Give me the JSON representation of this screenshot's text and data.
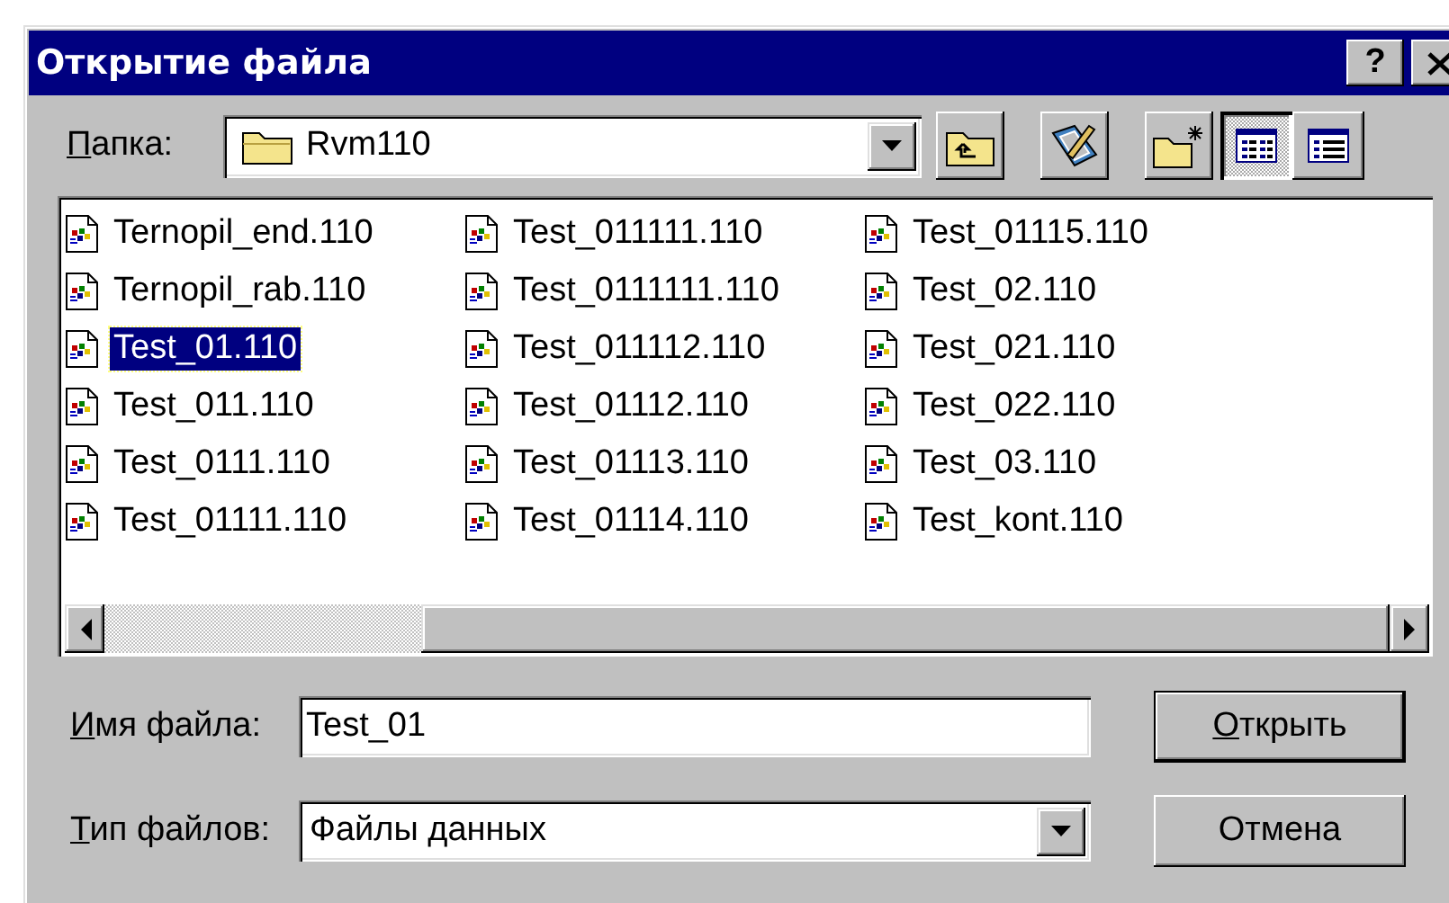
{
  "window": {
    "title": "Открытие файла",
    "help_button": "?"
  },
  "folder": {
    "label": "Папка:",
    "mnemonic": true,
    "value": "Rvm110"
  },
  "views": [
    {
      "kind": "list",
      "selected": true
    },
    {
      "kind": "details",
      "selected": false
    }
  ],
  "files": [
    {
      "name": "Ternopil_end.110",
      "selected": false
    },
    {
      "name": "Ternopil_rab.110",
      "selected": false
    },
    {
      "name": "Test_01.110",
      "selected": true
    },
    {
      "name": "Test_011.110",
      "selected": false
    },
    {
      "name": "Test_0111.110",
      "selected": false
    },
    {
      "name": "Test_01111.110",
      "selected": false
    },
    {
      "name": "Test_011111.110",
      "selected": false
    },
    {
      "name": "Test_0111111.110",
      "selected": false
    },
    {
      "name": "Test_011112.110",
      "selected": false
    },
    {
      "name": "Test_01112.110",
      "selected": false
    },
    {
      "name": "Test_01113.110",
      "selected": false
    },
    {
      "name": "Test_01114.110",
      "selected": false
    },
    {
      "name": "Test_01115.110",
      "selected": false
    },
    {
      "name": "Test_02.110",
      "selected": false
    },
    {
      "name": "Test_021.110",
      "selected": false
    },
    {
      "name": "Test_022.110",
      "selected": false
    },
    {
      "name": "Test_03.110",
      "selected": false
    },
    {
      "name": "Test_kont.110",
      "selected": false
    }
  ],
  "file_name": {
    "label": "Имя файла:",
    "mnemonic": true,
    "value": "Test_01"
  },
  "file_type": {
    "label": "Тип файлов:",
    "mnemonic": true,
    "value": "Файлы данных"
  },
  "buttons": [
    {
      "label": "Открыть",
      "default": true,
      "mnemonic": true
    },
    {
      "label": "Отмена",
      "default": false,
      "mnemonic": false
    }
  ]
}
